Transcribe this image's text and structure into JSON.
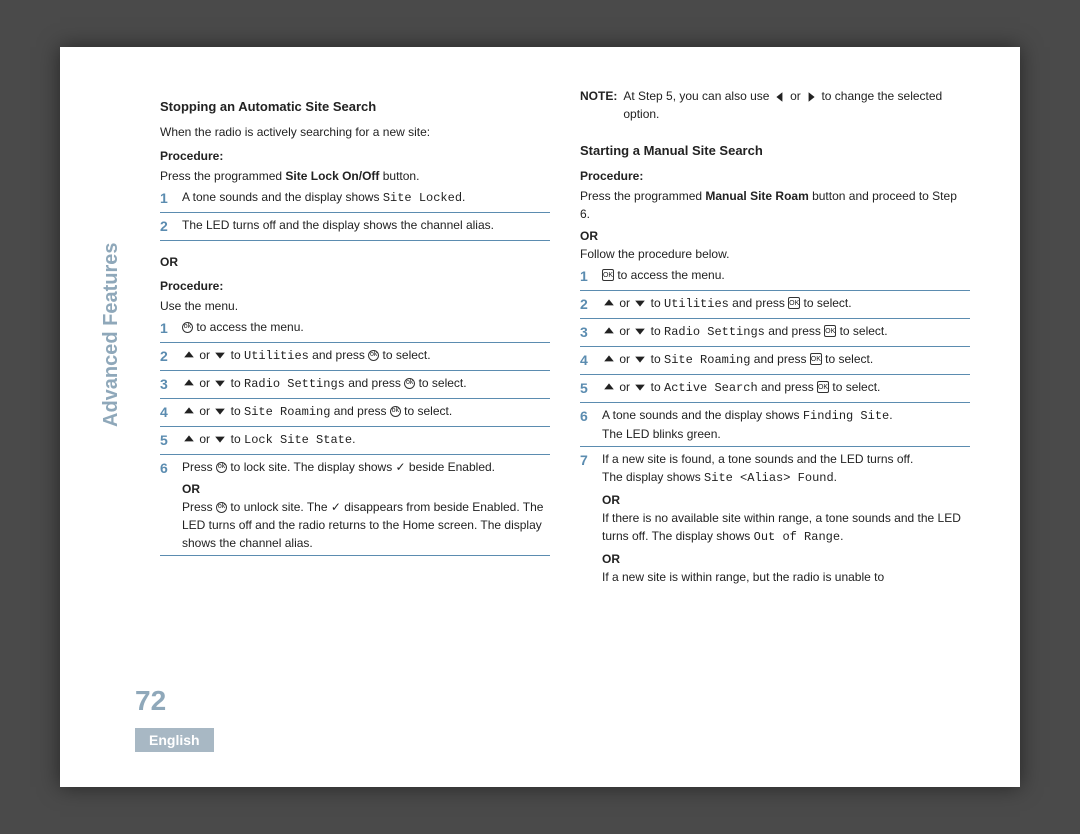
{
  "sidebar": {
    "label": "Advanced Features"
  },
  "page_number": "72",
  "language": "English",
  "left": {
    "heading1": "Stopping an Automatic Site Search",
    "intro1": "When the radio is actively searching for a new site:",
    "procedure_label": "Procedure:",
    "proc1_line": "Press the programmed Site Lock On/Off button.",
    "proc1_bold": "Site Lock On/Off",
    "step1": {
      "num": "1",
      "text_a": "A tone sounds and the display shows ",
      "mono": "Site Locked",
      "text_b": "."
    },
    "step2": {
      "num": "2",
      "text": "The LED turns off and the display shows the channel alias."
    },
    "or": "OR",
    "proc2_line": "Use the menu.",
    "m1": {
      "num": "1",
      "text": " to access the menu."
    },
    "m2": {
      "num": "2",
      "text_a": " or ",
      "text_b": " to ",
      "mono": "Utilities",
      "text_c": " and press ",
      "text_d": " to select."
    },
    "m3": {
      "num": "3",
      "text_a": " or ",
      "text_b": " to ",
      "mono": "Radio Settings",
      "text_c": " and press ",
      "text_d": " to select."
    },
    "m4": {
      "num": "4",
      "text_a": " or ",
      "text_b": " to ",
      "mono": "Site Roaming",
      "text_c": " and press ",
      "text_d": " to select."
    },
    "m5": {
      "num": "5",
      "text_a": " or ",
      "text_b": " to ",
      "mono": "Lock Site State",
      "text_c": "."
    },
    "m6": {
      "num": "6",
      "line1_a": "Press ",
      "line1_b": " to lock site. The display shows ✓ beside Enabled.",
      "or": "OR",
      "line2_a": "Press ",
      "line2_b": " to unlock site. The ✓ disappears from beside Enabled. The LED turns off and the radio returns to the Home screen. The display shows the channel alias."
    }
  },
  "right": {
    "note_label": "NOTE:",
    "note_text_a": "At Step 5, you can also use ",
    "note_text_b": " or ",
    "note_text_c": " to change the selected option.",
    "heading": "Starting a Manual Site Search",
    "procedure_label": "Procedure:",
    "proc_line_a": "Press the programmed ",
    "proc_bold": "Manual Site Roam",
    "proc_line_b": " button and proceed to Step 6.",
    "or": "OR",
    "follow": "Follow the procedure below.",
    "s1": {
      "num": "1",
      "text": " to access the menu."
    },
    "s2": {
      "num": "2",
      "text_a": " or ",
      "text_b": " to ",
      "mono": "Utilities",
      "text_c": " and press ",
      "text_d": " to select."
    },
    "s3": {
      "num": "3",
      "text_a": " or ",
      "text_b": " to ",
      "mono": "Radio Settings",
      "text_c": " and press ",
      "text_d": " to select."
    },
    "s4": {
      "num": "4",
      "text_a": " or ",
      "text_b": " to ",
      "mono": "Site Roaming",
      "text_c": " and press ",
      "text_d": " to select."
    },
    "s5": {
      "num": "5",
      "text_a": " or ",
      "text_b": " to ",
      "mono": "Active Search",
      "text_c": " and press ",
      "text_d": " to select."
    },
    "s6": {
      "num": "6",
      "text_a": "A tone sounds and the display shows ",
      "mono": "Finding Site",
      "text_b": ".",
      "line2": "The LED blinks green."
    },
    "s7": {
      "num": "7",
      "line1": "If a new site is found, a tone sounds and the LED turns off.",
      "line2_a": "The display shows ",
      "mono2": "Site <Alias> Found",
      "line2_b": ".",
      "or1": "OR",
      "line3_a": "If there is no available site within range, a tone sounds and the LED turns off. The display shows ",
      "mono3": "Out of Range",
      "line3_b": ".",
      "or2": "OR",
      "line4": "If a new site is within range, but the radio is unable to"
    }
  }
}
